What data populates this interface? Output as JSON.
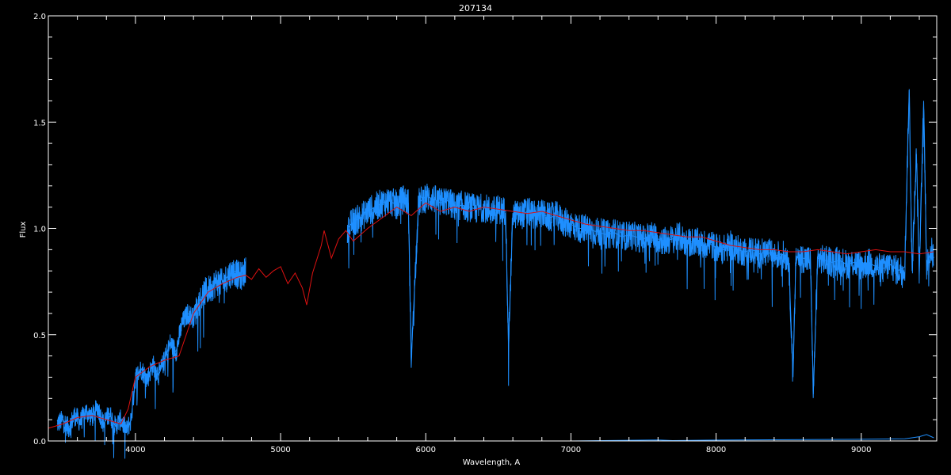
{
  "chart_data": {
    "type": "line",
    "title": "207134",
    "xlabel": "Wavelength, A",
    "ylabel": "Flux",
    "xlim": [
      3400,
      9520
    ],
    "ylim": [
      0.0,
      2.0
    ],
    "x_ticks": [
      4000,
      5000,
      6000,
      7000,
      8000,
      9000
    ],
    "x_tick_labels": [
      "4000",
      "5000",
      "6000",
      "7000",
      "8000",
      "9000"
    ],
    "y_ticks": [
      0.0,
      0.5,
      1.0,
      1.5,
      2.0
    ],
    "y_tick_labels": [
      "0.0",
      "0.5",
      "1.0",
      "1.5",
      "2.0"
    ],
    "grid": false,
    "colors": {
      "background": "#000000",
      "axes": "#ffffff",
      "observed": "#1e8fff",
      "model": "#dd1111",
      "error": "#1e8fff"
    },
    "series": [
      {
        "role": "model",
        "x": [
          3400,
          3500,
          3600,
          3700,
          3800,
          3900,
          3950,
          4000,
          4100,
          4200,
          4300,
          4400,
          4500,
          4600,
          4700,
          4760,
          4800,
          4850,
          4900,
          4950,
          5000,
          5050,
          5100,
          5150,
          5180,
          5220,
          5280,
          5300,
          5350,
          5400,
          5450,
          5500,
          5600,
          5700,
          5800,
          5900,
          6000,
          6100,
          6200,
          6300,
          6400,
          6500,
          6600,
          6700,
          6800,
          6900,
          7000,
          7100,
          7200,
          7300,
          7400,
          7500,
          7600,
          7700,
          7800,
          7900,
          8000,
          8100,
          8200,
          8300,
          8400,
          8500,
          8600,
          8700,
          8800,
          8900,
          9000,
          9100,
          9200,
          9300,
          9400,
          9500
        ],
        "y": [
          0.06,
          0.08,
          0.11,
          0.12,
          0.1,
          0.08,
          0.15,
          0.3,
          0.35,
          0.38,
          0.4,
          0.6,
          0.7,
          0.74,
          0.77,
          0.78,
          0.76,
          0.81,
          0.77,
          0.8,
          0.82,
          0.74,
          0.79,
          0.72,
          0.64,
          0.79,
          0.92,
          0.99,
          0.86,
          0.95,
          0.99,
          0.94,
          1.0,
          1.05,
          1.1,
          1.06,
          1.12,
          1.08,
          1.1,
          1.08,
          1.1,
          1.09,
          1.08,
          1.07,
          1.08,
          1.06,
          1.04,
          1.02,
          1.01,
          1.0,
          0.99,
          0.99,
          0.98,
          0.97,
          0.96,
          0.96,
          0.94,
          0.92,
          0.91,
          0.9,
          0.9,
          0.89,
          0.89,
          0.9,
          0.89,
          0.88,
          0.89,
          0.9,
          0.89,
          0.89,
          0.88,
          0.89
        ]
      },
      {
        "role": "observed",
        "segments": [
          {
            "x": [
              3460,
              3500,
              3540,
              3580,
              3620,
              3660,
              3700,
              3740,
              3780,
              3820,
              3860,
              3900,
              3940,
              3970,
              4000,
              4040,
              4080,
              4120,
              4160,
              4200,
              4240,
              4280,
              4320,
              4360,
              4400,
              4440,
              4480,
              4520,
              4560,
              4600,
              4640,
              4680,
              4720,
              4760
            ],
            "y": [
              0.08,
              0.1,
              0.06,
              0.12,
              0.09,
              0.14,
              0.11,
              0.16,
              0.08,
              0.13,
              0.07,
              0.1,
              0.05,
              0.1,
              0.3,
              0.34,
              0.29,
              0.36,
              0.31,
              0.38,
              0.46,
              0.42,
              0.55,
              0.6,
              0.58,
              0.66,
              0.7,
              0.72,
              0.75,
              0.74,
              0.78,
              0.8,
              0.77,
              0.8
            ]
          },
          {
            "x": [
              5460,
              5500,
              5550,
              5600,
              5650,
              5700,
              5750,
              5800,
              5850,
              5880,
              5900,
              5950,
              6000,
              6050,
              6100,
              6150,
              6200,
              6250,
              6300,
              6350,
              6400,
              6450,
              6500,
              6550,
              6570,
              6600,
              6650,
              6700,
              6750,
              6800,
              6850,
              6900,
              6950,
              7000,
              7050,
              7100,
              7150,
              7200,
              7250,
              7300,
              7350,
              7400,
              7450,
              7500,
              7550,
              7600,
              7650,
              7700,
              7750,
              7800,
              7850,
              7900,
              7950,
              8000,
              8050,
              8100,
              8150,
              8200,
              8250,
              8300,
              8350,
              8400,
              8450,
              8500,
              8530,
              8550,
              8600,
              8650,
              8670,
              8700,
              8750,
              8800,
              8850,
              8900,
              8950,
              9000,
              9050,
              9100,
              9150,
              9200,
              9250,
              9300,
              9330,
              9350,
              9380,
              9400,
              9430,
              9450,
              9480,
              9500
            ],
            "y": [
              1.0,
              1.03,
              1.05,
              1.08,
              1.1,
              1.12,
              1.13,
              1.11,
              1.14,
              1.12,
              0.38,
              1.12,
              1.15,
              1.14,
              1.12,
              1.13,
              1.1,
              1.11,
              1.1,
              1.09,
              1.1,
              1.08,
              1.09,
              1.08,
              0.45,
              1.07,
              1.06,
              1.08,
              1.06,
              1.07,
              1.05,
              1.06,
              1.03,
              1.02,
              1.0,
              1.0,
              0.99,
              0.98,
              0.97,
              0.98,
              0.96,
              0.97,
              0.96,
              0.95,
              0.97,
              0.95,
              0.94,
              0.95,
              0.96,
              0.93,
              0.94,
              0.92,
              0.93,
              0.91,
              0.9,
              0.92,
              0.9,
              0.89,
              0.9,
              0.88,
              0.89,
              0.87,
              0.88,
              0.86,
              0.3,
              0.87,
              0.86,
              0.85,
              0.22,
              0.86,
              0.85,
              0.84,
              0.85,
              0.83,
              0.84,
              0.82,
              0.84,
              0.82,
              0.81,
              0.83,
              0.8,
              0.82,
              1.65,
              0.8,
              1.35,
              0.78,
              1.6,
              0.82,
              0.9,
              0.86
            ]
          }
        ]
      },
      {
        "role": "error",
        "x": [
          3400,
          4000,
          5000,
          6000,
          7000,
          7600,
          7700,
          8000,
          8500,
          9000,
          9300,
          9400,
          9450,
          9500
        ],
        "y": [
          0.0,
          0.0,
          0.0,
          0.0,
          0.0,
          0.005,
          0.002,
          0.004,
          0.006,
          0.008,
          0.01,
          0.02,
          0.03,
          0.015
        ]
      }
    ]
  }
}
